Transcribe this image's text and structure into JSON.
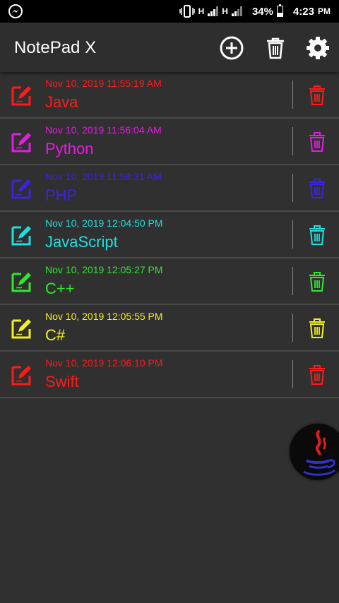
{
  "status_bar": {
    "network_1": "H",
    "network_2": "H",
    "battery": "34%",
    "time": "4:23",
    "ampm": "PM"
  },
  "app_bar": {
    "title": "NotePad X",
    "actions": [
      "add-icon",
      "trash-icon",
      "settings-icon"
    ]
  },
  "notes": [
    {
      "date": "Nov 10, 2019 11:55:19 AM",
      "title": "Java",
      "color": "#ff1a1a"
    },
    {
      "date": "Nov 10, 2019 11:56:04 AM",
      "title": "Python",
      "color": "#e51be5"
    },
    {
      "date": "Nov 10, 2019 11:58:31 AM",
      "title": "PHP",
      "color": "#3b22e6"
    },
    {
      "date": "Nov 10, 2019 12:04:50 PM",
      "title": "JavaScript",
      "color": "#1de0e0"
    },
    {
      "date": "Nov 10, 2019 12:05:27 PM",
      "title": "C++",
      "color": "#2ee82e"
    },
    {
      "date": "Nov 10, 2019 12:05:55 PM",
      "title": "C#",
      "color": "#f2f21f"
    },
    {
      "date": "Nov 10, 2019 12:06:10 PM",
      "title": "Swift",
      "color": "#ff1a1a"
    }
  ],
  "fab": {
    "icon": "java-logo-icon"
  }
}
